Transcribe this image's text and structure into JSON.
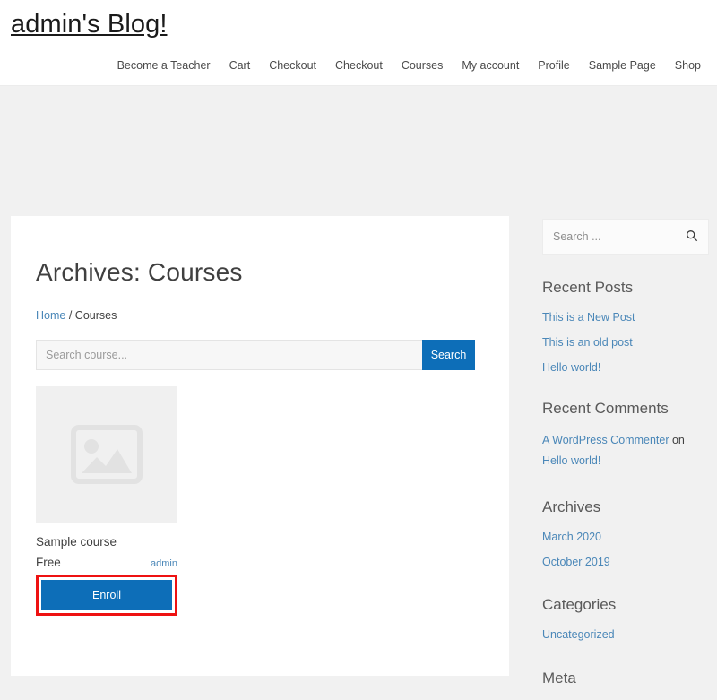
{
  "header": {
    "site_title": "admin's Blog!",
    "nav_items": [
      {
        "label": "Become a Teacher"
      },
      {
        "label": "Cart"
      },
      {
        "label": "Checkout"
      },
      {
        "label": "Checkout"
      },
      {
        "label": "Courses"
      },
      {
        "label": "My account"
      },
      {
        "label": "Profile"
      },
      {
        "label": "Sample Page"
      },
      {
        "label": "Shop"
      }
    ]
  },
  "main": {
    "archive_title": "Archives: Courses",
    "breadcrumb": {
      "home_label": "Home",
      "separator": "/",
      "current_label": "Courses"
    },
    "course_search": {
      "placeholder": "Search course...",
      "value": "",
      "button_label": "Search"
    },
    "courses": [
      {
        "name": "Sample course",
        "price": "Free",
        "author": "admin",
        "enroll_label": "Enroll",
        "thumb_icon": "image-placeholder-icon",
        "highlighted": true
      }
    ]
  },
  "sidebar": {
    "search": {
      "placeholder": "Search ...",
      "value": "",
      "icon": "search-icon"
    },
    "widgets": [
      {
        "title": "Recent Posts",
        "links": [
          "This is a New Post",
          "This is an old post",
          "Hello world!"
        ]
      },
      {
        "title": "Recent Comments",
        "comment": {
          "author": "A WordPress Commenter",
          "connector": "on",
          "post": "Hello world!"
        }
      },
      {
        "title": "Archives",
        "links": [
          "March 2020",
          "October 2019"
        ]
      },
      {
        "title": "Categories",
        "links": [
          "Uncategorized"
        ]
      },
      {
        "title": "Meta",
        "links": []
      }
    ]
  },
  "colors": {
    "accent_blue": "#0d6eb8",
    "link_blue": "#4a87b8",
    "highlight_red": "#ee1111",
    "page_background": "#f1f1f1",
    "card_background": "#ffffff",
    "thumb_background": "#f0f0f0"
  }
}
